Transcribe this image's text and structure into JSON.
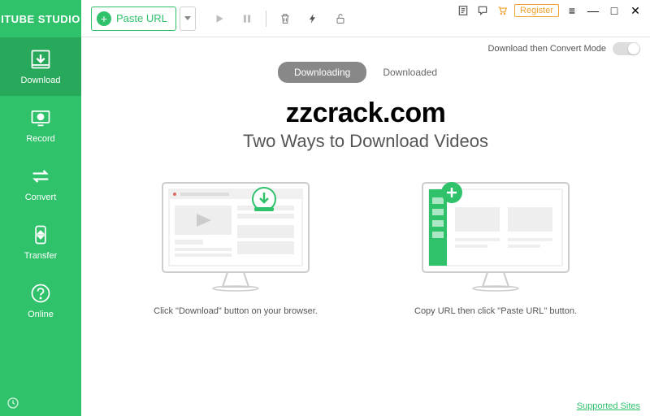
{
  "app": {
    "name": "ITUBE STUDIO"
  },
  "sidebar": {
    "items": [
      {
        "label": "Download"
      },
      {
        "label": "Record"
      },
      {
        "label": "Convert"
      },
      {
        "label": "Transfer"
      },
      {
        "label": "Online"
      }
    ]
  },
  "toolbar": {
    "paste_label": "Paste URL"
  },
  "topbar": {
    "register_label": "Register",
    "mode_label": "Download then Convert Mode"
  },
  "tabs": [
    {
      "label": "Downloading",
      "active": true
    },
    {
      "label": "Downloaded",
      "active": false
    }
  ],
  "content": {
    "watermark": "zzcrack.com",
    "subtitle": "Two Ways to Download Videos",
    "method1_text": "Click \"Download\" button on your browser.",
    "method2_text": "Copy URL then click \"Paste URL\" button."
  },
  "footer": {
    "supported_label": "Supported Sites"
  }
}
